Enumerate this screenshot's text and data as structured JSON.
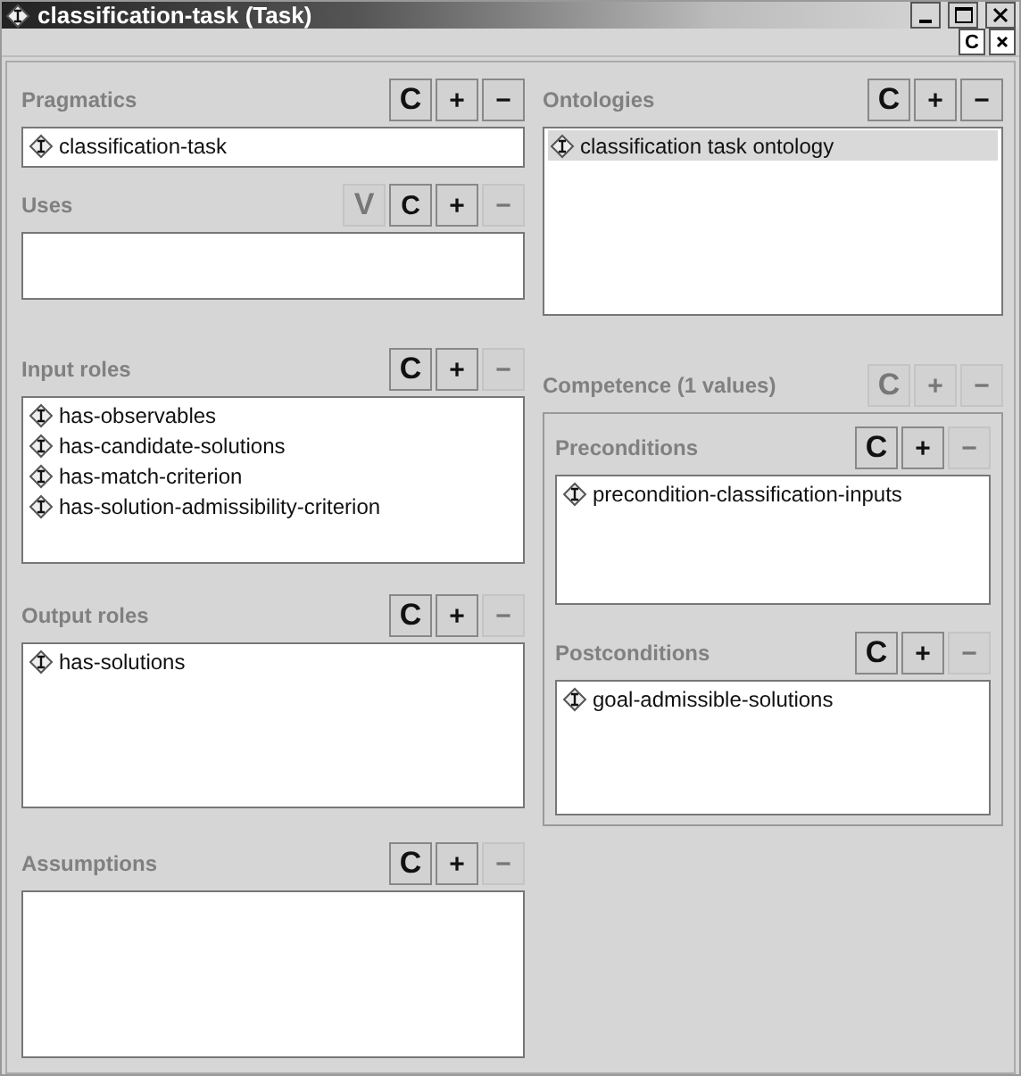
{
  "window": {
    "title": "classification-task (Task)"
  },
  "toolbar": {
    "buttons": [
      {
        "label": "C",
        "disabled": false
      }
    ]
  },
  "columns": [
    {
      "panels": [
        {
          "kind": "field",
          "title": "Pragmatics",
          "buttons": [
            {
              "label": "C",
              "disabled": false
            },
            {
              "label": "+",
              "disabled": false
            },
            {
              "label": "−",
              "disabled": false
            }
          ],
          "items": [
            {
              "label": "classification-task",
              "selected": false
            }
          ]
        },
        {
          "kind": "list",
          "title": "Uses",
          "buttons": [
            {
              "label": "V",
              "disabled": true
            },
            {
              "label": "C",
              "disabled": false
            },
            {
              "label": "+",
              "disabled": false
            },
            {
              "label": "−",
              "disabled": true
            }
          ]
        },
        {
          "kind": "list",
          "title": "Input roles",
          "buttons": [
            {
              "label": "C",
              "disabled": false
            },
            {
              "label": "+",
              "disabled": false
            },
            {
              "label": "−",
              "disabled": true
            }
          ],
          "items": [
            {
              "label": "has-observables",
              "selected": false
            },
            {
              "label": "has-candidate-solutions",
              "selected": false
            },
            {
              "label": "has-match-criterion",
              "selected": false
            },
            {
              "label": "has-solution-admissibility-criterion",
              "selected": false
            }
          ]
        },
        {
          "kind": "list",
          "title": "Output roles",
          "buttons": [
            {
              "label": "C",
              "disabled": false
            },
            {
              "label": "+",
              "disabled": false
            },
            {
              "label": "−",
              "disabled": true
            }
          ],
          "items": [
            {
              "label": "has-solutions",
              "selected": false
            }
          ]
        },
        {
          "kind": "list",
          "title": "Assumptions",
          "buttons": [
            {
              "label": "C",
              "disabled": false
            },
            {
              "label": "+",
              "disabled": false
            },
            {
              "label": "−",
              "disabled": true
            }
          ]
        }
      ]
    },
    {
      "panels": [
        {
          "kind": "list",
          "title": "Ontologies",
          "buttons": [
            {
              "label": "C",
              "disabled": false
            },
            {
              "label": "+",
              "disabled": false
            },
            {
              "label": "−",
              "disabled": false
            }
          ],
          "items": [
            {
              "label": "classification task ontology",
              "selected": true
            }
          ]
        },
        {
          "kind": "group",
          "title": "Competence (1 values)",
          "buttons": [
            {
              "label": "C",
              "disabled": true
            },
            {
              "label": "+",
              "disabled": true
            },
            {
              "label": "−",
              "disabled": true
            }
          ],
          "sections": [
            {
              "title": "Preconditions",
              "buttons": [
                {
                  "label": "C",
                  "disabled": false
                },
                {
                  "label": "+",
                  "disabled": false
                },
                {
                  "label": "−",
                  "disabled": true
                }
              ],
              "items": [
                {
                  "label": "precondition-classification-inputs",
                  "selected": false
                }
              ]
            },
            {
              "title": "Postconditions",
              "buttons": [
                {
                  "label": "C",
                  "disabled": false
                },
                {
                  "label": "+",
                  "disabled": false
                },
                {
                  "label": "−",
                  "disabled": true
                }
              ],
              "items": [
                {
                  "label": "goal-admissible-solutions",
                  "selected": false
                }
              ]
            }
          ]
        }
      ]
    }
  ]
}
